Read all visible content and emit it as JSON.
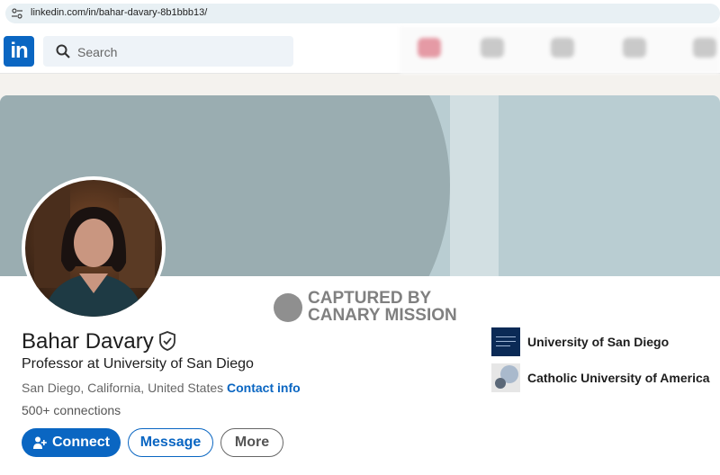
{
  "browser": {
    "url": "linkedin.com/in/bahar-davary-8b1bbb13/"
  },
  "nav": {
    "logo_text": "in",
    "search_placeholder": "Search"
  },
  "watermark": {
    "line1": "CAPTURED BY",
    "line2": "CANARY MISSION"
  },
  "profile": {
    "name": "Bahar Davary",
    "headline": "Professor at University of San Diego",
    "location": "San Diego, California, United States ·",
    "contact_label": "Contact info",
    "connections": "500+ connections"
  },
  "actions": {
    "connect": "Connect",
    "message": "Message",
    "more": "More"
  },
  "education": [
    {
      "name": "University of San Diego",
      "logo": "usd-logo"
    },
    {
      "name": "Catholic University of America",
      "logo": "cua-logo"
    }
  ],
  "colors": {
    "brand": "#0a66c2",
    "cover": "#9aadb1"
  }
}
